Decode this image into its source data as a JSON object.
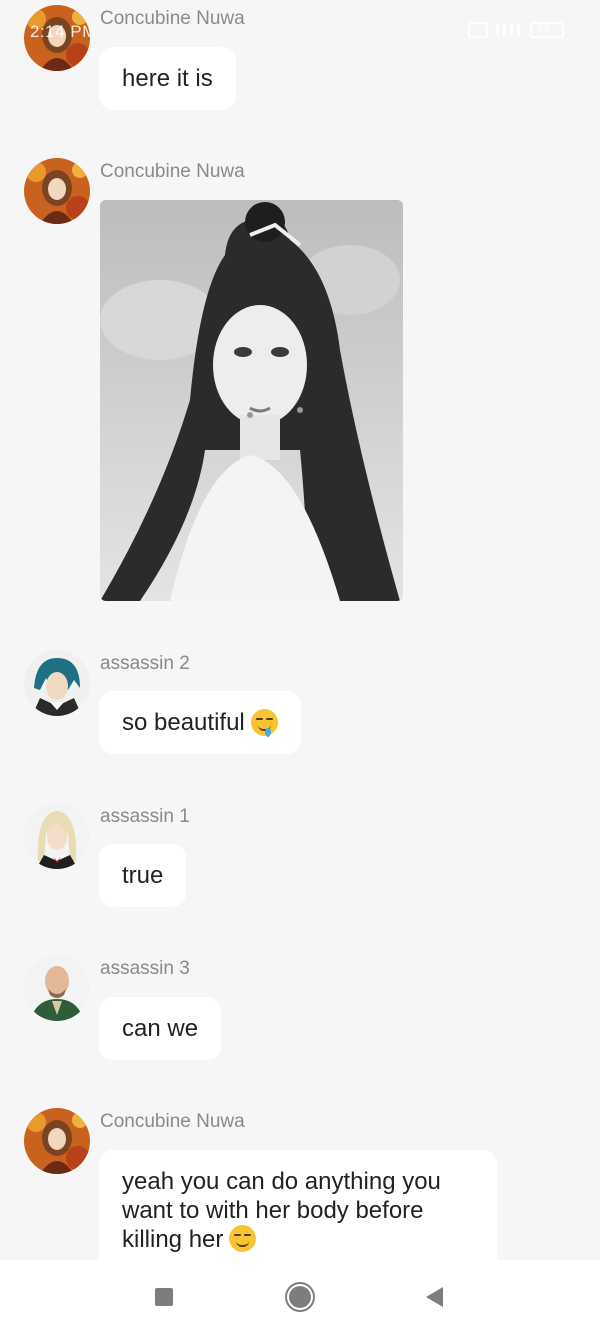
{
  "status_bar": {
    "time": "2:14 PM",
    "battery": "24"
  },
  "messages": [
    {
      "sender": "Concubine Nuwa",
      "text": "here it is",
      "avatar_icon": "woman-autumn-avatar"
    },
    {
      "sender": "Concubine Nuwa",
      "text": "",
      "attachment": "image-woman-long-hair",
      "avatar_icon": "woman-autumn-avatar"
    },
    {
      "sender": "assassin 2",
      "text": "so beautiful",
      "emoji": "drooling-face-emoji",
      "avatar_icon": "blue-hair-man-avatar"
    },
    {
      "sender": "assassin 1",
      "text": "true",
      "avatar_icon": "blonde-man-avatar"
    },
    {
      "sender": "assassin 3",
      "text": "can we",
      "avatar_icon": "bald-man-avatar"
    },
    {
      "sender": "Concubine Nuwa",
      "text_lines": [
        "yeah you can do anything you",
        "want to with her body before",
        "killing her"
      ],
      "emoji": "smirking-face-emoji",
      "avatar_icon": "woman-autumn-avatar"
    }
  ],
  "colors": {
    "background": "#f6f6f6",
    "bubble": "#ffffff",
    "name_text": "#8a8a8a",
    "message_text": "#222222"
  },
  "nav_icons": [
    "recent-apps-icon",
    "home-icon",
    "back-icon"
  ]
}
